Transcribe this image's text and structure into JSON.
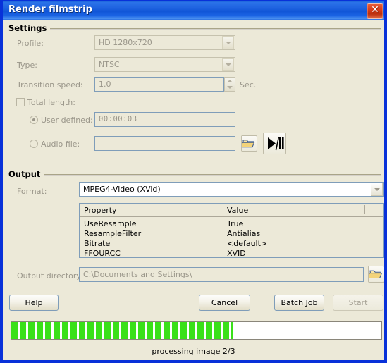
{
  "window": {
    "title": "Render filmstrip",
    "close_icon": "close-x-icon"
  },
  "settings": {
    "group_label": "Settings",
    "profile": {
      "label": "Profile:",
      "value": "HD 1280x720",
      "enabled": false
    },
    "type": {
      "label": "Type:",
      "value": "NTSC",
      "enabled": false
    },
    "transition_speed": {
      "label": "Transition speed:",
      "value": "1.0",
      "unit": "Sec.",
      "enabled": false
    },
    "total_length": {
      "label": "Total length:",
      "checked": false
    },
    "user_defined": {
      "label": "User defined:",
      "value": "00:00:03",
      "selected": true
    },
    "audio_file": {
      "label": "Audio file:",
      "value": "",
      "selected": false,
      "browse_icon": "folder-open-icon",
      "play_pause_icon": "play-pause-icon",
      "play_pause_glyph": "▶/❙❙"
    }
  },
  "output": {
    "group_label": "Output",
    "format": {
      "label": "Format:",
      "value": "MPEG4-Video (XVid)"
    },
    "table": {
      "columns": [
        "Property",
        "Value"
      ],
      "rows": [
        {
          "property": "UseResample",
          "value": "True"
        },
        {
          "property": "ResampleFilter",
          "value": "Antialias"
        },
        {
          "property": "Bitrate",
          "value": "<default>"
        },
        {
          "property": "FFOURCC",
          "value": "XVID"
        }
      ]
    },
    "directory": {
      "label": "Output directory:",
      "value": "C:\\Documents and Settings\\",
      "browse_icon": "folder-open-icon"
    }
  },
  "buttons": {
    "help": "Help",
    "cancel": "Cancel",
    "batch_job": "Batch Job",
    "start": "Start",
    "start_enabled": false
  },
  "progress": {
    "percent": 60,
    "status": "processing image 2/3"
  },
  "colors": {
    "titlebar_blue": "#0831d9",
    "dialog_face": "#ece9d8",
    "progress_green": "#3ae019",
    "close_red": "#d73b18"
  }
}
